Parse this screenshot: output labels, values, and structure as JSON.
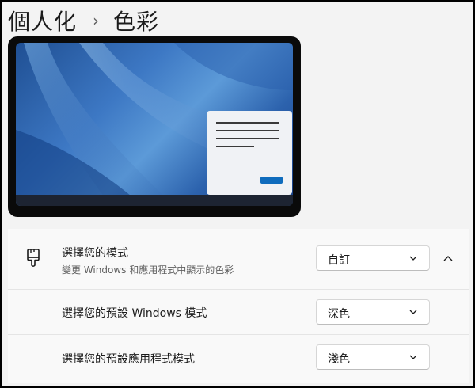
{
  "breadcrumb": {
    "parent": "個人化",
    "separator": "›",
    "current": "色彩"
  },
  "colors": {
    "accent": "#0f6cbd",
    "text": "#1b1b1b",
    "secondary_text": "#5f5f5f"
  },
  "settings": {
    "mode": {
      "title": "選擇您的模式",
      "description": "變更 Windows 和應用程式中顯示的色彩",
      "icon": "paint-brush-icon",
      "value": "自訂",
      "expanded": true
    },
    "windows_mode": {
      "label": "選擇您的預設 Windows 模式",
      "value": "深色"
    },
    "app_mode": {
      "label": "選擇您的預設應用程式模式",
      "value": "淺色"
    }
  }
}
